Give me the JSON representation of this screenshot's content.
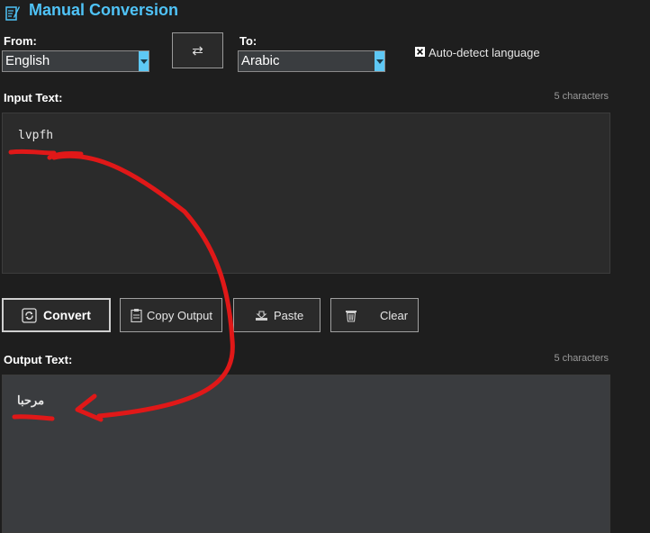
{
  "header": {
    "title": "Manual Conversion",
    "icon": "edit-note-icon"
  },
  "language": {
    "from_label": "From:",
    "from_value": "English",
    "to_label": "To:",
    "to_value": "Arabic",
    "swap_icon": "swap-arrows-icon",
    "swap_glyph": "⇄",
    "auto_detect_label": "Auto-detect language",
    "auto_detect_checked": true
  },
  "input": {
    "label": "Input Text:",
    "count": "5 characters",
    "value": "lvpfh"
  },
  "actions": {
    "convert": "Convert",
    "copy_output": "Copy Output",
    "paste": "Paste",
    "clear": "Clear"
  },
  "output": {
    "label": "Output Text:",
    "count": "5 characters",
    "value": "مرحبا"
  },
  "colors": {
    "background": "#1e1e1e",
    "accent": "#4fc3f7",
    "dropdown_button": "#5ec8f5",
    "annotation": "#e01818"
  }
}
